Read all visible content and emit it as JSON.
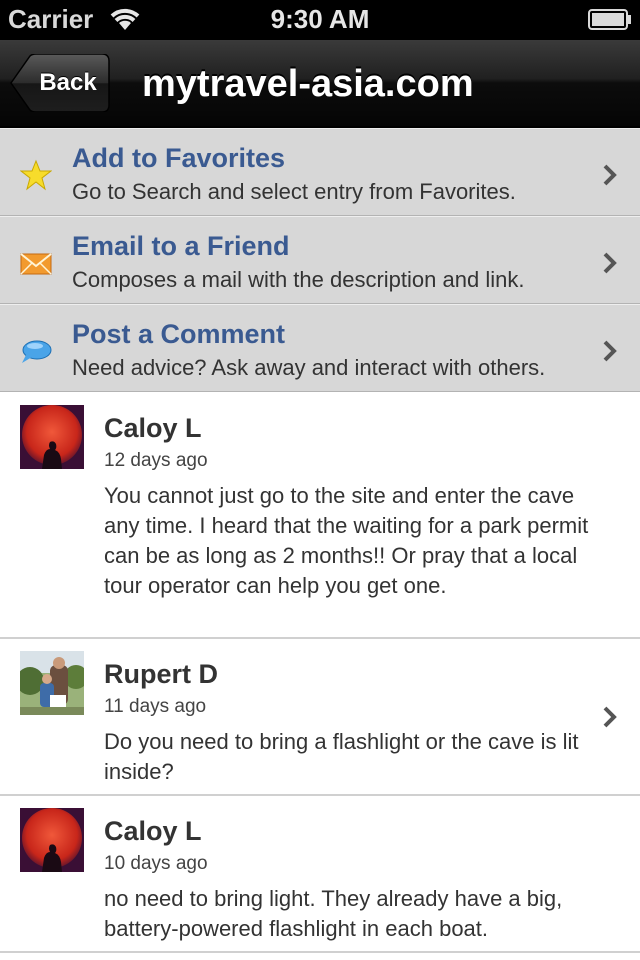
{
  "status_bar": {
    "carrier": "Carrier",
    "time": "9:30 AM",
    "wifi_icon": "wifi-icon",
    "battery_icon": "battery-icon"
  },
  "nav": {
    "back_label": "Back",
    "title": "mytravel-asia.com"
  },
  "actions": [
    {
      "title": "Add to Favorites",
      "subtitle": "Go to Search and select entry from Favorites.",
      "icon": "star-icon"
    },
    {
      "title": "Email to a Friend",
      "subtitle": "Composes a mail with the description and link.",
      "icon": "envelope-icon"
    },
    {
      "title": "Post a Comment",
      "subtitle": "Need advice? Ask away and interact with others.",
      "icon": "speech-bubble-icon"
    }
  ],
  "comments": [
    {
      "name": "Caloy L",
      "time": "12 days ago",
      "body": "You cannot just go to the site and enter the cave any time. I heard that the waiting for a park permit can be as long as 2 months!!  Or pray that a local tour operator can help you get one.",
      "has_disclosure": false
    },
    {
      "name": "Rupert D",
      "time": "11 days ago",
      "body": "Do you need to bring a flashlight or the cave is lit inside?",
      "has_disclosure": true
    },
    {
      "name": "Caloy L",
      "time": "10 days ago",
      "body": "no need to bring light. They already have a big, battery-powered flashlight in each boat.",
      "has_disclosure": false
    }
  ],
  "colors": {
    "link_title": "#3a5a91",
    "action_bg": "#d7d7d7",
    "nav_bg": "#111111"
  }
}
